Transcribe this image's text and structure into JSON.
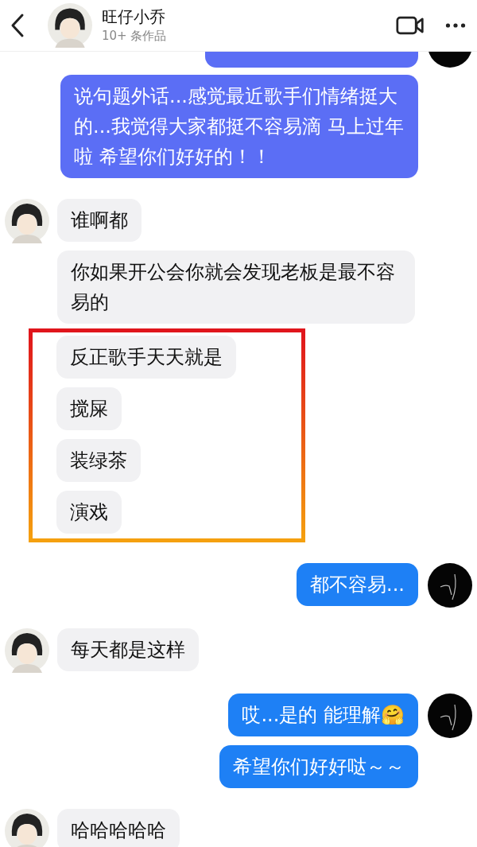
{
  "header": {
    "name": "旺仔小乔",
    "subtitle": "10+ 条作品"
  },
  "blocks": [
    {
      "kind": "cut_sent",
      "color": "#5b6ef5"
    },
    {
      "kind": "sent",
      "avatar": false,
      "color": "#5b6ef5",
      "text": "说句题外话...感觉最近歌手们情绪挺大的...我觉得大家都挺不容易滴 马上过年啦 希望你们好好的！！"
    },
    {
      "kind": "received",
      "avatar": true,
      "text": "谁啊都"
    },
    {
      "kind": "received",
      "avatar": false,
      "text": "你如果开公会你就会发现老板是最不容易的"
    },
    {
      "kind": "highlight",
      "messages": [
        {
          "text": "反正歌手天天就是"
        },
        {
          "text": "搅屎"
        },
        {
          "text": "装绿茶"
        },
        {
          "text": "演戏"
        }
      ]
    },
    {
      "kind": "sent",
      "avatar": true,
      "color": "#1e80f5",
      "text": "都不容易..."
    },
    {
      "kind": "received",
      "avatar": true,
      "text": "每天都是这样"
    },
    {
      "kind": "sent",
      "avatar": true,
      "color": "#1e80f5",
      "text": "哎...是的 能理解🤗"
    },
    {
      "kind": "sent",
      "avatar": false,
      "color": "#1e80f5",
      "text": "希望你们好好哒～～"
    },
    {
      "kind": "received",
      "avatar": true,
      "text": "哈哈哈哈哈"
    }
  ]
}
